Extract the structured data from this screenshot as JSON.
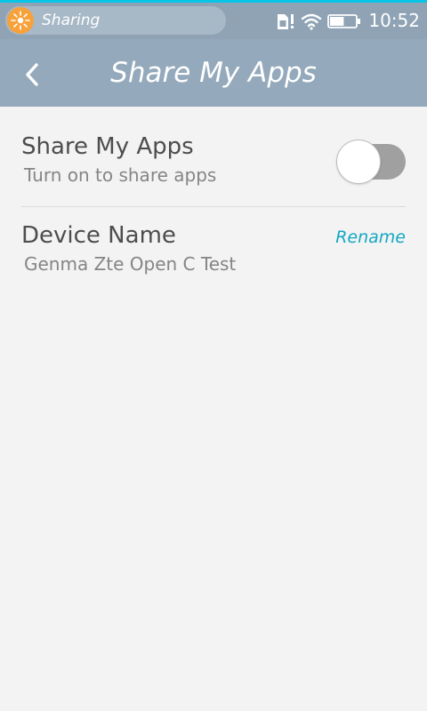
{
  "status_bar": {
    "notification_text": "Sharing",
    "time": "10:52",
    "icons": [
      "app-notification-icon",
      "sim-alert-icon",
      "wifi-icon",
      "battery-icon"
    ],
    "battery_level": 0.55
  },
  "header": {
    "title": "Share My Apps",
    "back_icon": "chevron-left-icon"
  },
  "settings": {
    "share": {
      "title": "Share My Apps",
      "subtitle": "Turn on to share apps",
      "enabled": false
    },
    "device": {
      "title": "Device Name",
      "value": "Genma Zte Open C Test",
      "action_label": "Rename"
    }
  },
  "colors": {
    "accent_top_line": "#06c5e6",
    "header_bg": "#94a9bb",
    "link": "#12a8c2",
    "toggle_track_off": "#a0a0a0"
  }
}
